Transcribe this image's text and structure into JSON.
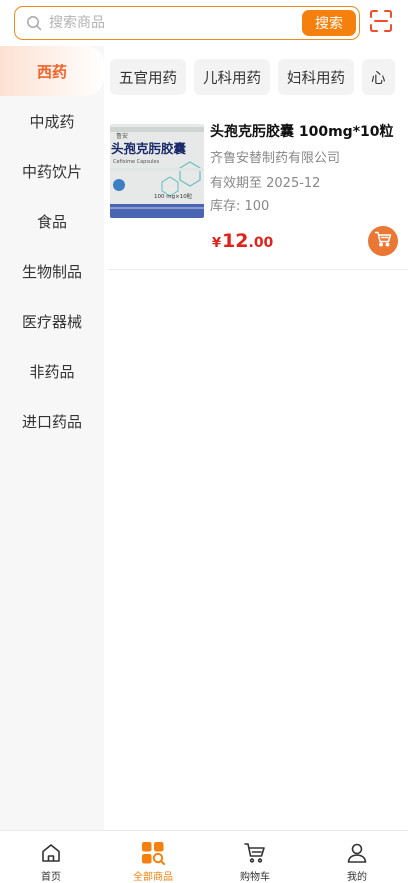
{
  "search": {
    "placeholder": "搜索商品",
    "button_label": "搜索"
  },
  "sidebar": {
    "items": [
      {
        "label": "西药",
        "active": true
      },
      {
        "label": "中成药",
        "active": false
      },
      {
        "label": "中药饮片",
        "active": false
      },
      {
        "label": "食品",
        "active": false
      },
      {
        "label": "生物制品",
        "active": false
      },
      {
        "label": "医疗器械",
        "active": false
      },
      {
        "label": "非药品",
        "active": false
      },
      {
        "label": "进口药品",
        "active": false
      }
    ]
  },
  "subtabs": [
    "五官用药",
    "儿科用药",
    "妇科用药",
    "心"
  ],
  "products": [
    {
      "name": "头孢克肟胶囊 100mg*10粒",
      "manufacturer": "齐鲁安替制药有限公司",
      "expiry": "有效期至 2025-12",
      "stock": "库存: 100",
      "price_symbol": "¥",
      "price_int": "12",
      "price_dec": ".00",
      "image_box_title": "头孢克肟胶囊",
      "image_box_subtitle": "Cefixime Capsules",
      "image_box_spec": "100 mg×10粒",
      "image_box_brand": "鲁安"
    }
  ],
  "bottom_nav": [
    {
      "label": "首页",
      "icon": "home-icon",
      "active": false
    },
    {
      "label": "全部商品",
      "icon": "all-products-icon",
      "active": true
    },
    {
      "label": "购物车",
      "icon": "cart-icon",
      "active": false
    },
    {
      "label": "我的",
      "icon": "profile-icon",
      "active": false
    }
  ],
  "colors": {
    "accent": "#f5800d",
    "active_category": "#f4632a",
    "price": "#e0221c",
    "cart_button": "#e87834"
  }
}
